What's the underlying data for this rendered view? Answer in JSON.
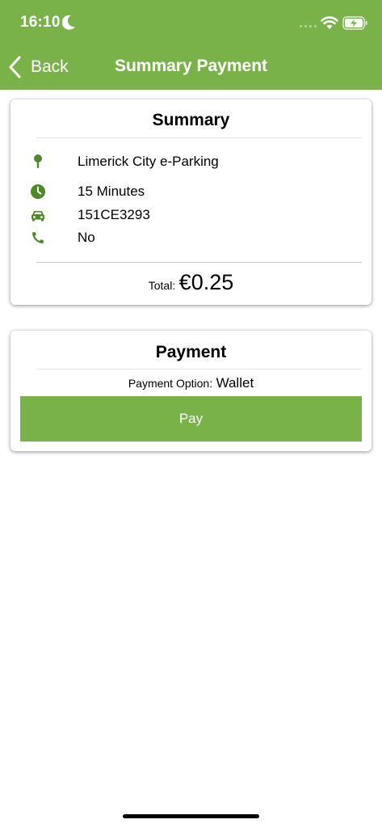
{
  "status_bar": {
    "time": "16:10"
  },
  "nav": {
    "back_label": "Back",
    "title": "Summary Payment"
  },
  "summary": {
    "title": "Summary",
    "rows": [
      {
        "icon": "location-pin-icon",
        "text": "Limerick City e-Parking"
      },
      {
        "icon": "clock-icon",
        "text": "15 Minutes"
      },
      {
        "icon": "car-icon",
        "text": "151CE3293"
      },
      {
        "icon": "phone-icon",
        "text": "No"
      }
    ],
    "total_label": "Total:",
    "total_value": "€0.25"
  },
  "payment": {
    "title": "Payment",
    "option_label": "Payment Option:",
    "option_value": "Wallet",
    "pay_label": "Pay"
  },
  "colors": {
    "accent": "#7ab24a",
    "icon": "#4c8a2a"
  }
}
